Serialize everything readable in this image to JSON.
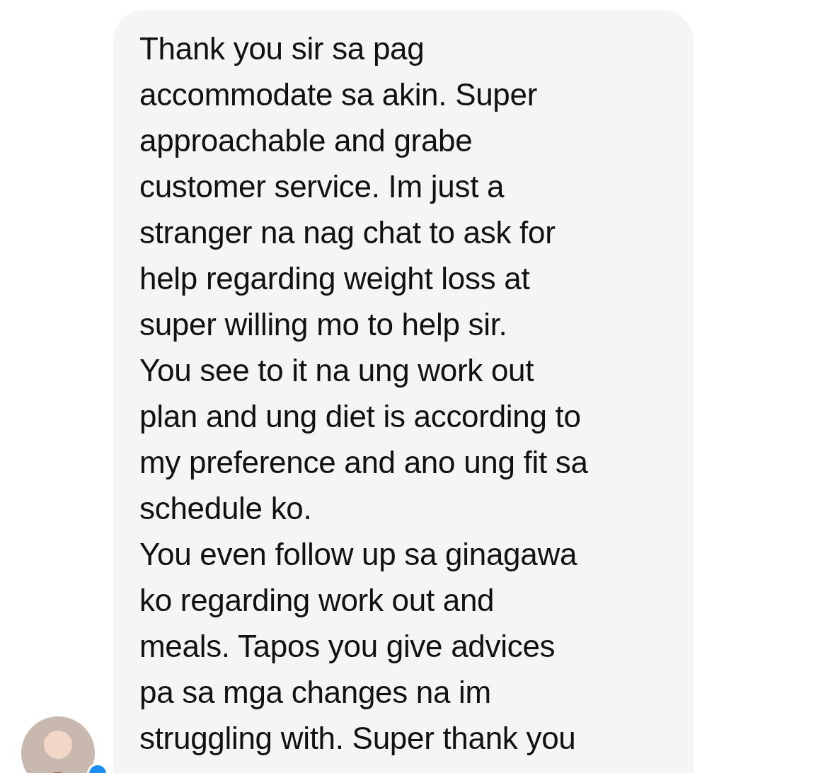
{
  "message": {
    "paragraphs": [
      {
        "lines": [
          "Thank you sir sa pag",
          "accommodate sa akin. Super",
          "approachable and grabe",
          "customer service. Im just a",
          "stranger na nag chat to ask for",
          "help regarding weight loss at",
          "super willing mo to help sir."
        ]
      },
      {
        "lines": [
          "You see to it na ung work out",
          "plan and ung diet is according to",
          "my preference and ano ung fit sa",
          "schedule ko."
        ]
      },
      {
        "lines": [
          "You even follow up sa ginagawa",
          "ko regarding work out and",
          "meals. Tapos you give advices",
          "pa sa mga changes na im",
          "struggling with. Super thank you"
        ]
      }
    ]
  },
  "sender": {
    "online": true
  }
}
